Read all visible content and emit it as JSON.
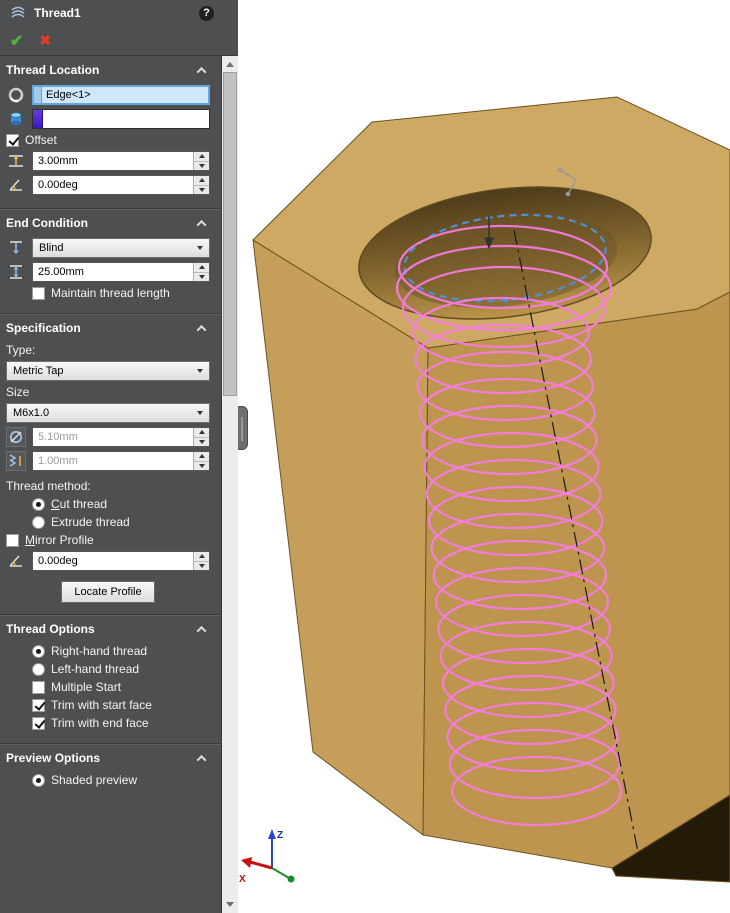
{
  "titlebar": {
    "title": "Thread1",
    "help_glyph": "?",
    "ok_glyph": "✔",
    "cancel_glyph": "✖"
  },
  "thread_location": {
    "title": "Thread Location",
    "edge_value": "Edge<1>",
    "offset_label": "Offset",
    "offset_distance": "3.00mm",
    "offset_angle": "0.00deg"
  },
  "end_condition": {
    "title": "End Condition",
    "type_value": "Blind",
    "depth": "25.00mm",
    "maintain_label": "Maintain thread length"
  },
  "specification": {
    "title": "Specification",
    "type_label": "Type:",
    "type_value": "Metric Tap",
    "size_label": "Size",
    "size_value": "M6x1.0",
    "major_diameter": "5.10mm",
    "pitch": "1.00mm",
    "method_label": "Thread method:",
    "cut_thread": "Cut thread",
    "extrude_thread": "Extrude thread",
    "mirror_profile": "Mirror Profile",
    "profile_angle": "0.00deg",
    "locate_profile": "Locate Profile"
  },
  "thread_options": {
    "title": "Thread Options",
    "right_hand": "Right-hand thread",
    "left_hand": "Left-hand thread",
    "multiple_start": "Multiple Start",
    "trim_start": "Trim with start face",
    "trim_end": "Trim with end face"
  },
  "preview_options": {
    "title": "Preview Options",
    "shaded": "Shaded preview"
  },
  "states": {
    "offset": true,
    "maintain": false,
    "cut_thread": true,
    "extrude_thread": false,
    "mirror_profile": false,
    "right_hand": true,
    "left_hand": false,
    "multiple_start": false,
    "trim_start": true,
    "trim_end": true,
    "shaded": true
  },
  "viewport": {
    "triad_x": "X",
    "triad_z": "Z"
  },
  "colors": {
    "panel_bg": "#4d4f51",
    "thread_preview": "#f87be4",
    "selected_edge": "#4f8fd6",
    "selection_bg": "#cfe8fb",
    "nut_top": "#cda964",
    "nut_left": "#c59f5a",
    "nut_front": "#bd954f"
  }
}
